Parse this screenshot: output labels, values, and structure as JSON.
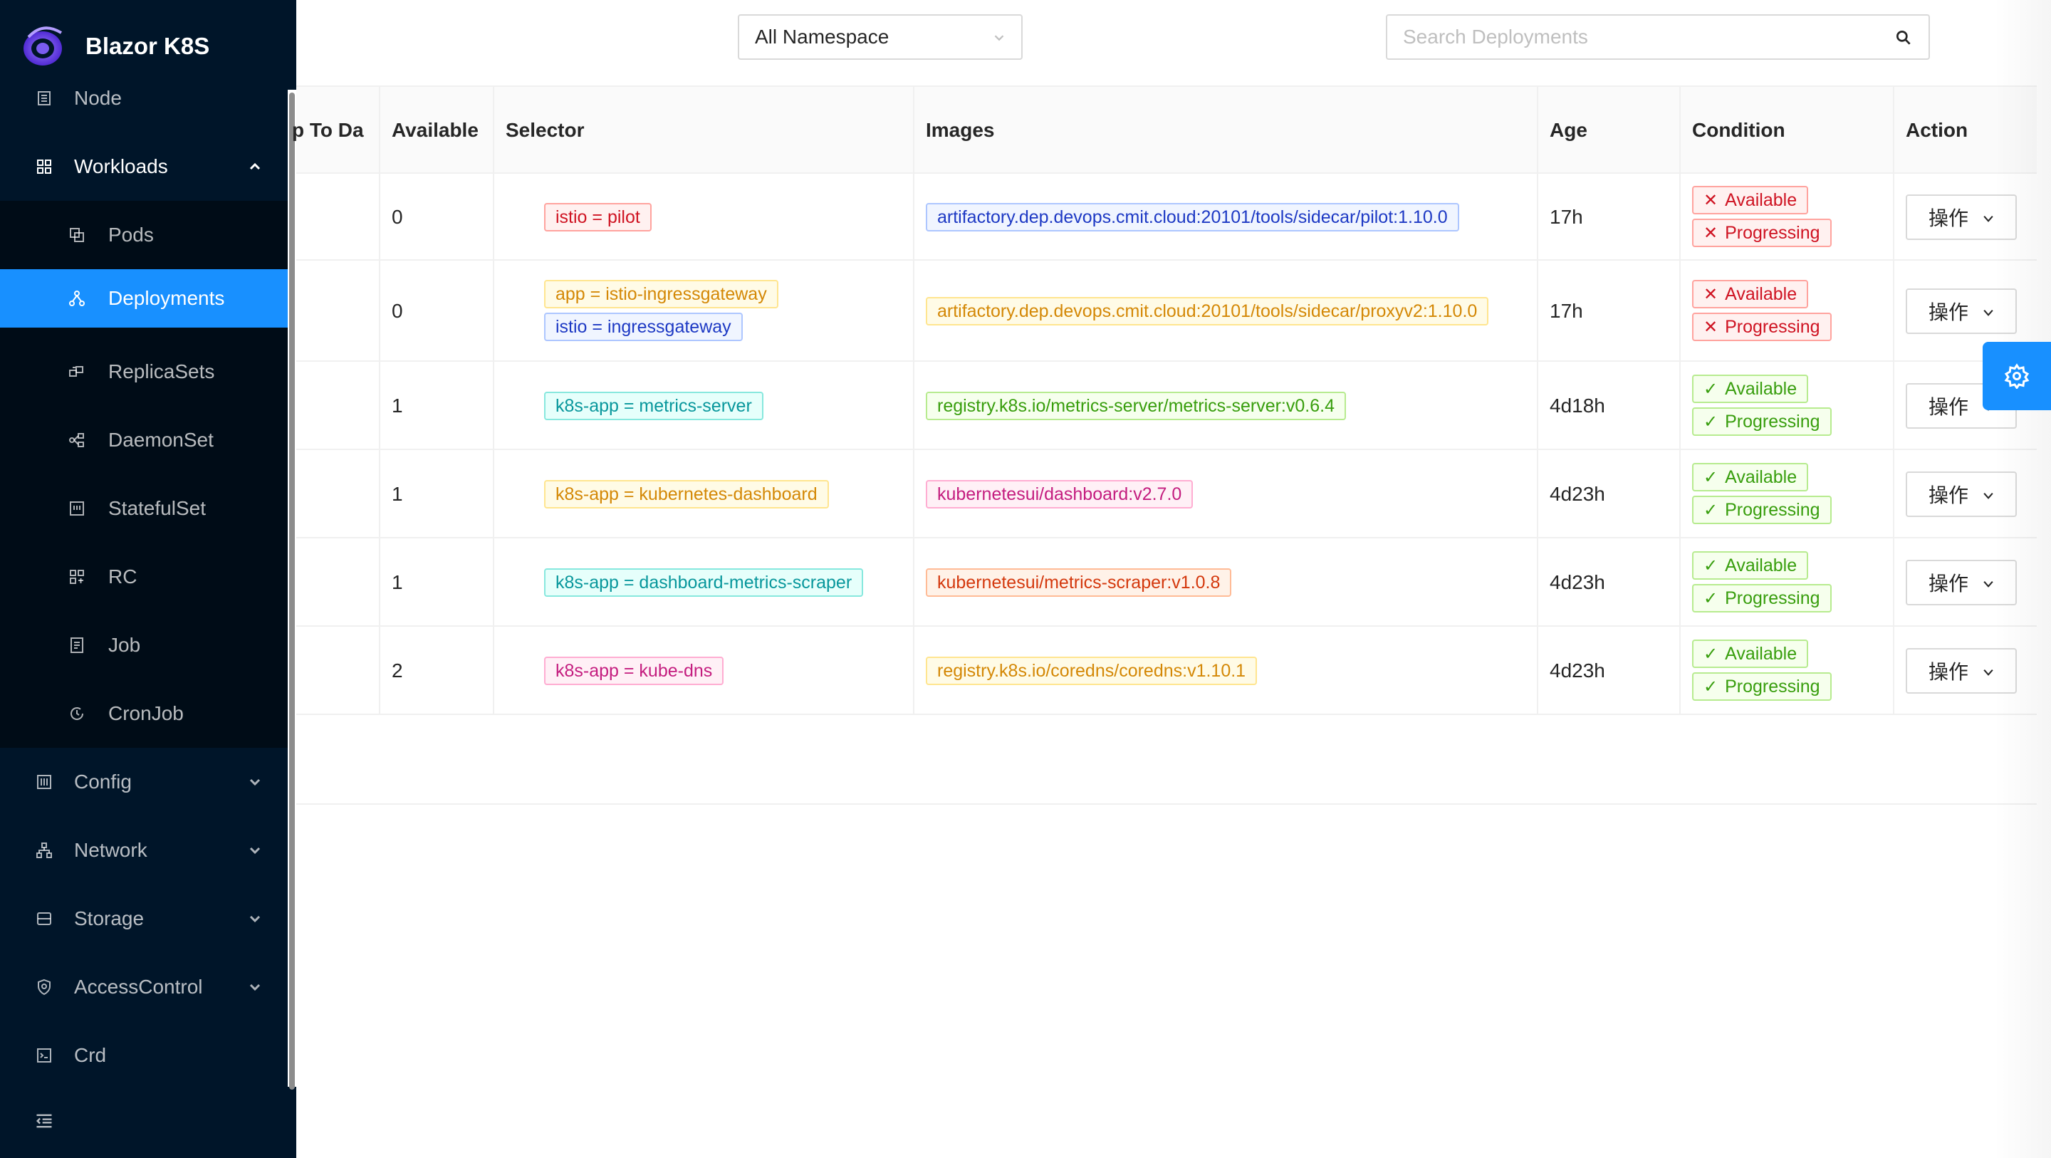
{
  "app": {
    "title": "Blazor K8S"
  },
  "sidebar": {
    "items": [
      {
        "label": "Node",
        "icon": "node-icon"
      },
      {
        "label": "Workloads",
        "icon": "appstore-icon",
        "expanded": true
      },
      {
        "label": "Config",
        "icon": "config-icon"
      },
      {
        "label": "Network",
        "icon": "network-icon"
      },
      {
        "label": "Storage",
        "icon": "storage-icon"
      },
      {
        "label": "AccessControl",
        "icon": "shield-icon"
      },
      {
        "label": "Crd",
        "icon": "code-icon"
      }
    ],
    "workloads_children": [
      {
        "label": "Pods",
        "icon": "pods-icon"
      },
      {
        "label": "Deployments",
        "icon": "deployment-icon",
        "selected": true
      },
      {
        "label": "ReplicaSets",
        "icon": "replicaset-icon"
      },
      {
        "label": "DaemonSet",
        "icon": "daemonset-icon"
      },
      {
        "label": "StatefulSet",
        "icon": "statefulset-icon"
      },
      {
        "label": "RC",
        "icon": "rc-icon"
      },
      {
        "label": "Job",
        "icon": "job-icon"
      },
      {
        "label": "CronJob",
        "icon": "cronjob-icon"
      }
    ]
  },
  "toolbar": {
    "namespace_selected": "All Namespace",
    "search_placeholder": "Search Deployments"
  },
  "table": {
    "columns": [
      "p To Da",
      "Available",
      "Selector",
      "Images",
      "Age",
      "Condition",
      "Action"
    ],
    "rows": [
      {
        "available": "0",
        "selectors": [
          "istio = pilot"
        ],
        "image": "artifactory.dep.devops.cmit.cloud:20101/tools/sidecar/pilot:1.10.0",
        "age": "17h",
        "conditions": [
          {
            "label": "Available",
            "ok": false
          },
          {
            "label": "Progressing",
            "ok": false
          }
        ],
        "action": "操作"
      },
      {
        "available": "0",
        "selectors": [
          "app = istio-ingressgateway",
          "istio = ingressgateway"
        ],
        "image": "artifactory.dep.devops.cmit.cloud:20101/tools/sidecar/proxyv2:1.10.0",
        "age": "17h",
        "conditions": [
          {
            "label": "Available",
            "ok": false
          },
          {
            "label": "Progressing",
            "ok": false
          }
        ],
        "action": "操作"
      },
      {
        "available": "1",
        "selectors": [
          "k8s-app = metrics-server"
        ],
        "image": "registry.k8s.io/metrics-server/metrics-server:v0.6.4",
        "age": "4d18h",
        "conditions": [
          {
            "label": "Available",
            "ok": true
          },
          {
            "label": "Progressing",
            "ok": true
          }
        ],
        "action": "操作"
      },
      {
        "available": "1",
        "selectors": [
          "k8s-app = kubernetes-dashboard"
        ],
        "image": "kubernetesui/dashboard:v2.7.0",
        "age": "4d23h",
        "conditions": [
          {
            "label": "Available",
            "ok": true
          },
          {
            "label": "Progressing",
            "ok": true
          }
        ],
        "action": "操作"
      },
      {
        "available": "1",
        "selectors": [
          "k8s-app = dashboard-metrics-scraper"
        ],
        "image": "kubernetesui/metrics-scraper:v1.0.8",
        "age": "4d23h",
        "conditions": [
          {
            "label": "Available",
            "ok": true
          },
          {
            "label": "Progressing",
            "ok": true
          }
        ],
        "action": "操作"
      },
      {
        "available": "2",
        "selectors": [
          "k8s-app = kube-dns"
        ],
        "image": "registry.k8s.io/coredns/coredns:v1.10.1",
        "age": "4d23h",
        "conditions": [
          {
            "label": "Available",
            "ok": true
          },
          {
            "label": "Progressing",
            "ok": true
          }
        ],
        "action": "操作"
      }
    ]
  },
  "marks": {
    "fail": "✕",
    "ok": "✓"
  },
  "colors": {
    "primary": "#1890ff",
    "sidebar_bg": "#001529",
    "submenu_bg": "#000c17"
  }
}
